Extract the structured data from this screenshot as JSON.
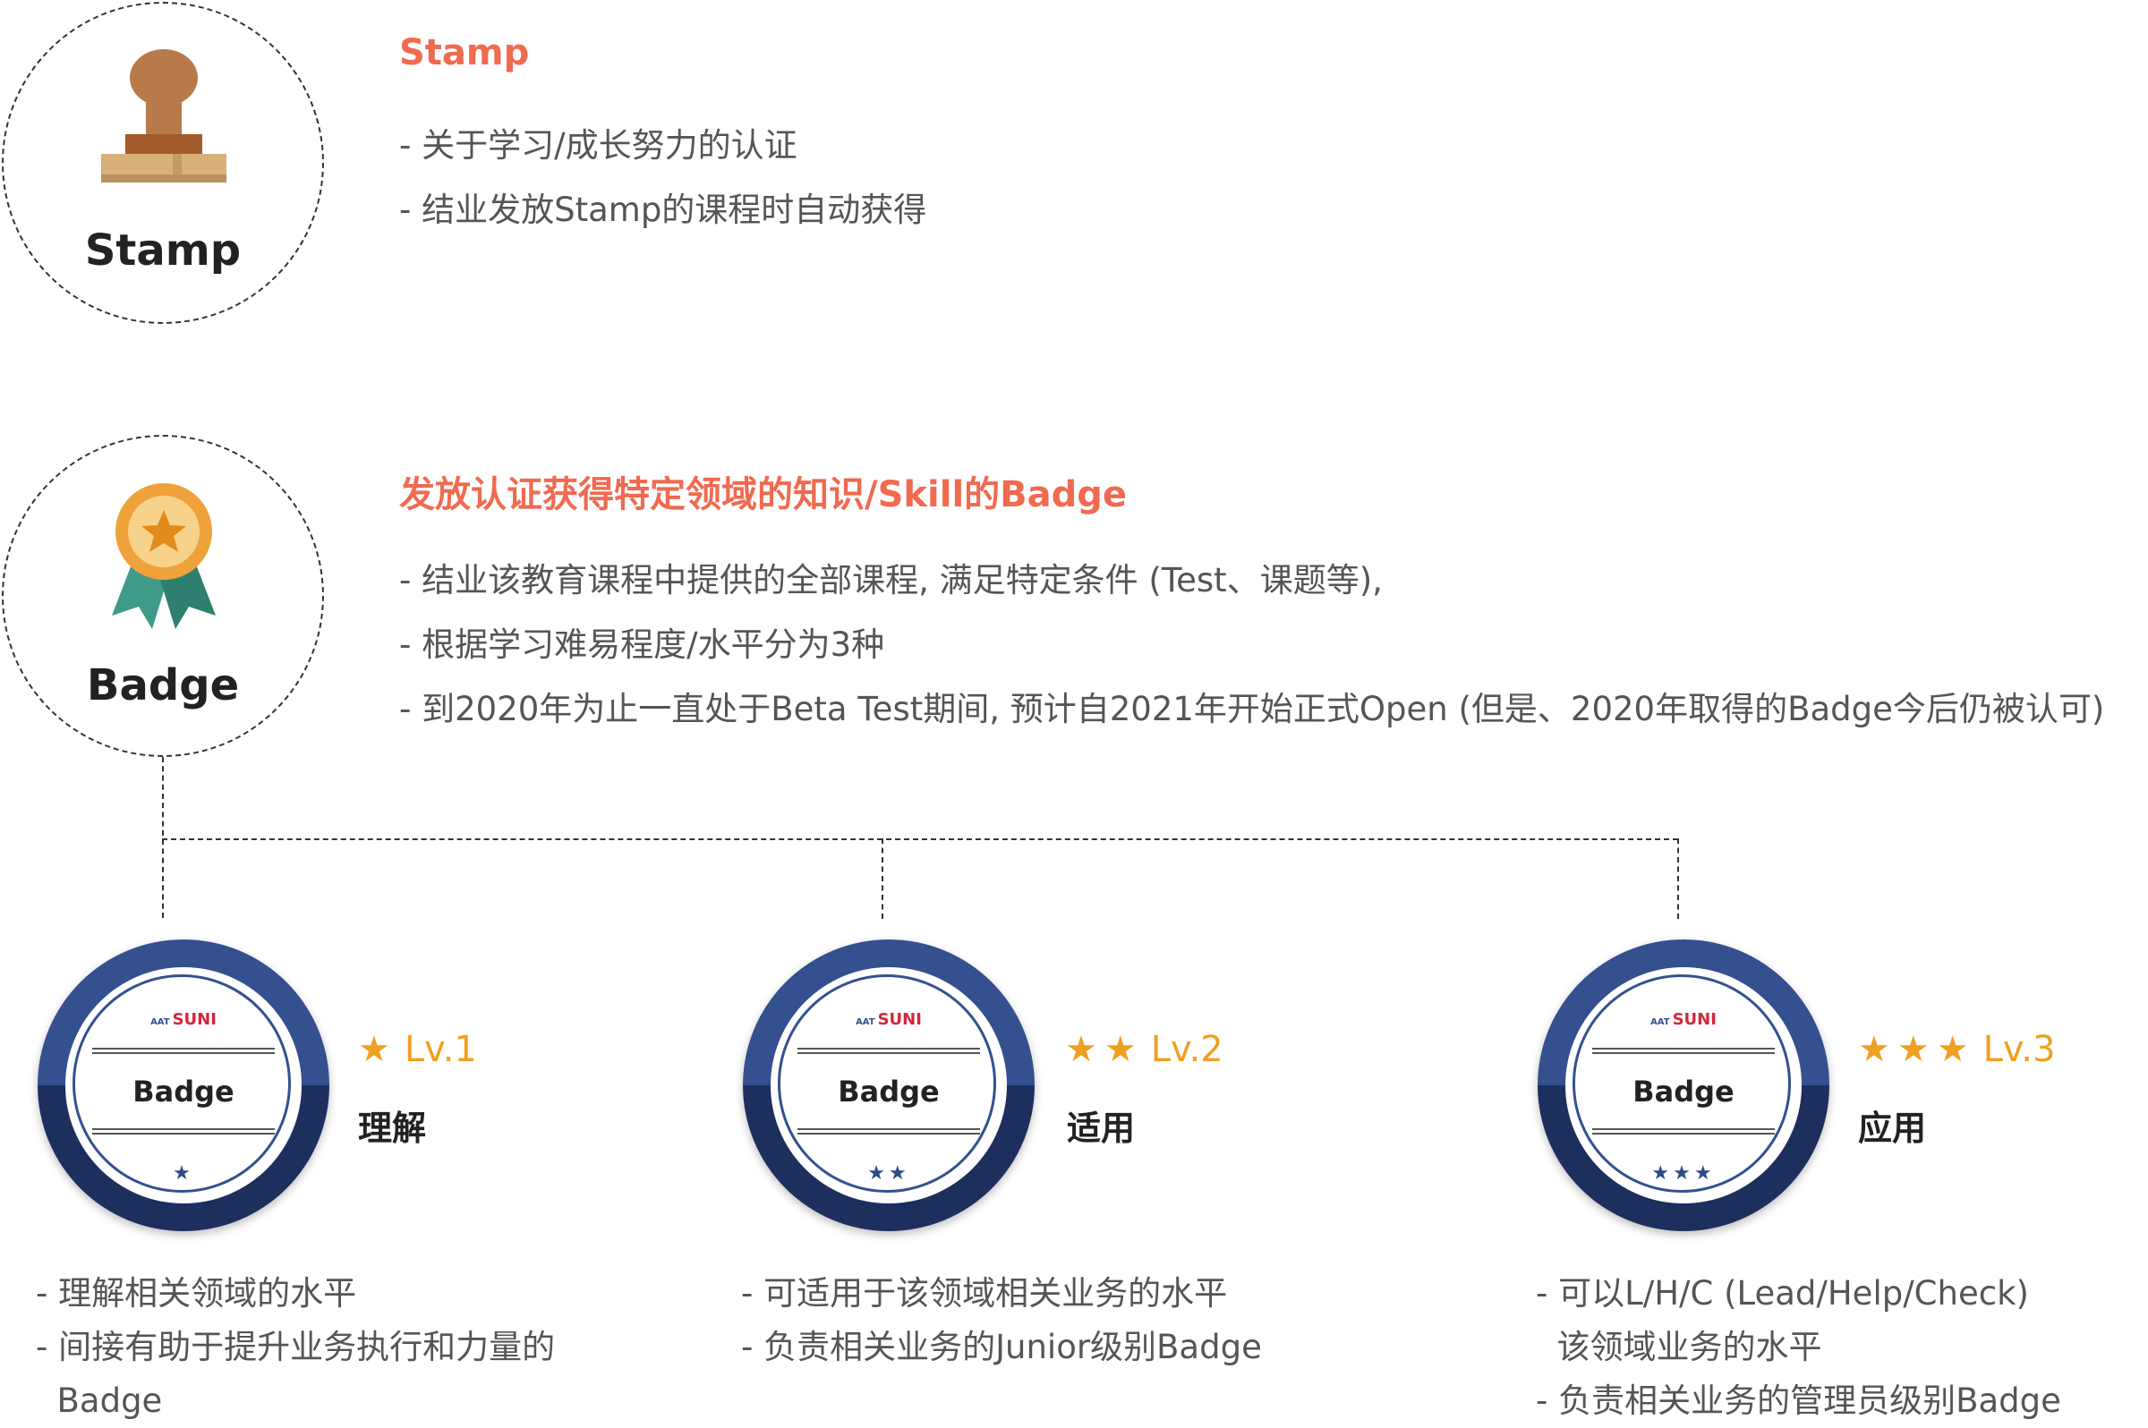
{
  "stamp": {
    "label": "Stamp",
    "title": "Stamp",
    "lines": [
      "- 关于学习/成长努力的认证",
      "- 结业发放Stamp的课程时自动获得"
    ]
  },
  "badge": {
    "label": "Badge",
    "title": "发放认证获得特定领域的知识/Skill的Badge",
    "lines": [
      "- 结业该教育课程中提供的全部课程, 满足特定条件 (Test、课题等),",
      "- 根据学习难易程度/水平分为3种",
      "- 到2020年为止一直处于Beta Test期间, 预计自2021年开始正式Open (但是、2020年取得的Badge今后仍被认可)"
    ]
  },
  "levels": [
    {
      "badge_logo_prefix": "AAT",
      "badge_logo": "SUNI",
      "badge_text": "Badge",
      "badge_stars": "★",
      "stars": "★",
      "level": "Lv.1",
      "name": "理解",
      "desc": [
        "- 理解相关领域的水平",
        "- 间接有助于提升业务执行和力量的",
        "  Badge"
      ]
    },
    {
      "badge_logo_prefix": "AAT",
      "badge_logo": "SUNI",
      "badge_text": "Badge",
      "badge_stars": "★★",
      "stars": "★★",
      "level": "Lv.2",
      "name": "适用",
      "desc": [
        "- 可适用于该领域相关业务的水平",
        "- 负责相关业务的Junior级别Badge"
      ]
    },
    {
      "badge_logo_prefix": "AAT",
      "badge_logo": "SUNI",
      "badge_text": "Badge",
      "badge_stars": "★★★",
      "stars": "★★★",
      "level": "Lv.3",
      "name": "应用",
      "desc": [
        "- 可以L/H/C (Lead/Help/Check)",
        "  该领域业务的水平",
        "- 负责相关业务的管理员级别Badge"
      ]
    }
  ],
  "colors": {
    "accent": "#f06a50",
    "star": "#f0a020",
    "badge_navy": "#1d2f5d",
    "badge_blue": "#34508f"
  }
}
